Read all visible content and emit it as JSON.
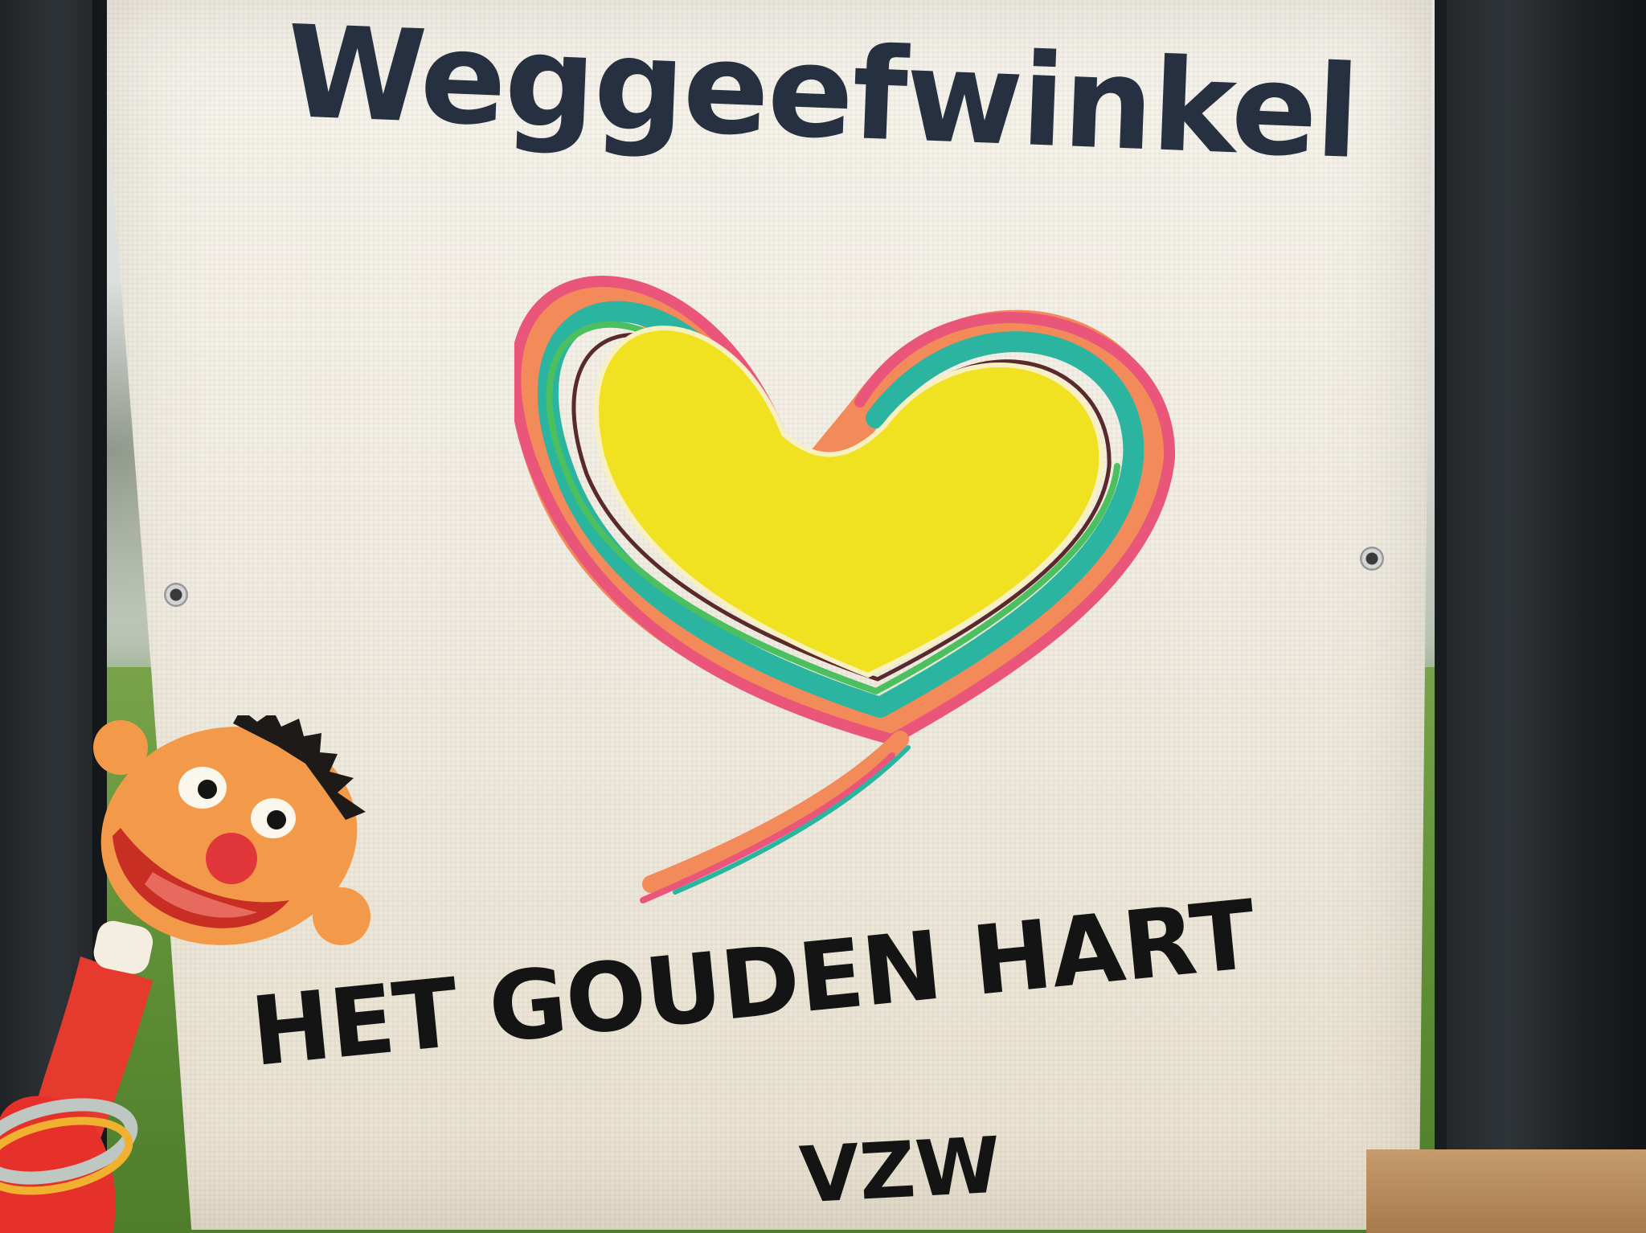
{
  "banner": {
    "title": "Weggeefwinkel",
    "org_name": "HET GOUDEN HART",
    "org_type": "VZW"
  },
  "colors": {
    "title_text": "#263040",
    "org_text": "#141414",
    "heart_fill": "#f0e220",
    "heart_strokes": [
      "#f28a5a",
      "#e9567a",
      "#2bb5a0",
      "#f7b54a",
      "#4cbf5e",
      "#e05050",
      "#1f9ec9"
    ],
    "banner_fabric": "#f3efe6",
    "puppet_face": "#f39a4a",
    "puppet_nose": "#e2373a",
    "puppet_shirt": "#e73a2e",
    "window_frame": "#23272a",
    "lawn": "#5f8f36"
  },
  "icons": {
    "logo": "golden-heart-icon",
    "puppet": "ernie-puppet"
  }
}
